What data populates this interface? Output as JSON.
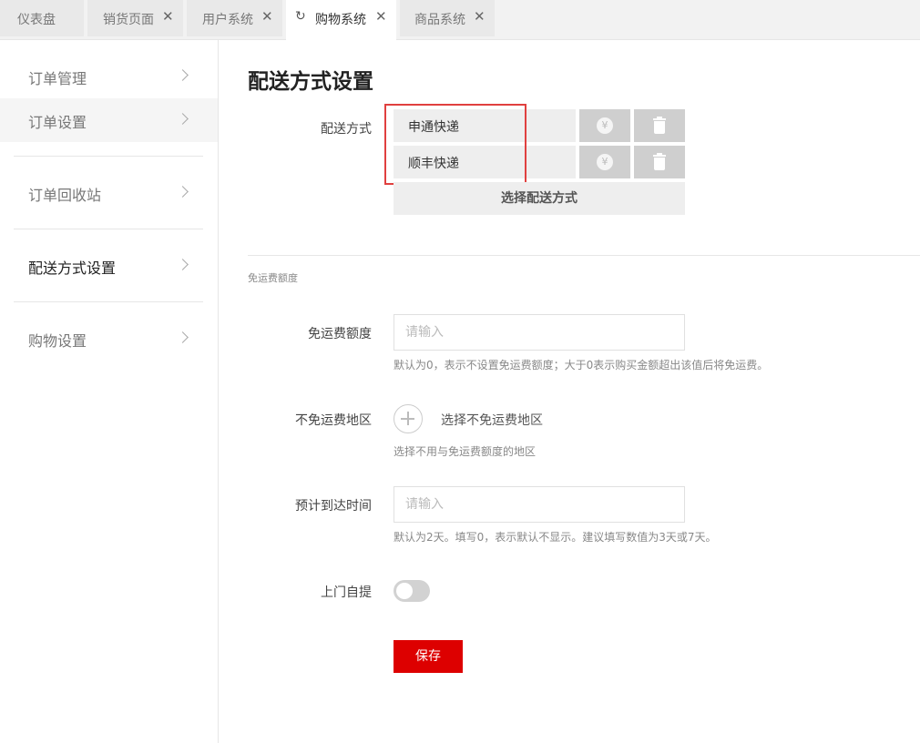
{
  "tabs": [
    {
      "label": "仪表盘",
      "closable": false
    },
    {
      "label": "销货页面",
      "closable": true,
      "close_glyph": "✕"
    },
    {
      "label": "用户系统",
      "closable": true,
      "close_glyph": "✕"
    },
    {
      "label": "购物系统",
      "closable": true,
      "active": true,
      "close_glyph": "✕",
      "icon": "reload-icon"
    },
    {
      "label": "商品系统",
      "closable": true,
      "close_glyph": "✕"
    }
  ],
  "sidebar": {
    "items": [
      {
        "label": "订单管理"
      },
      {
        "label": "订单设置"
      },
      {
        "label": "订单回收站"
      },
      {
        "label": "配送方式设置",
        "active": true
      },
      {
        "label": "购物设置"
      }
    ]
  },
  "page": {
    "title": "配送方式设置"
  },
  "shipping": {
    "label": "配送方式",
    "methods": [
      {
        "name": "申通快递"
      },
      {
        "name": "顺丰快递"
      }
    ],
    "price_icon_glyph": "¥",
    "choose_button": "选择配送方式"
  },
  "free_shipping": {
    "section_label": "免运费额度",
    "amount": {
      "label": "免运费额度",
      "placeholder": "请输入",
      "hint": "默认为0，表示不设置免运费额度；大于0表示购买金额超出该值后将免运费。"
    },
    "excluded_regions": {
      "label": "不免运费地区",
      "action": "选择不免运费地区",
      "hint": "选择不用与免运费额度的地区"
    },
    "arrival_time": {
      "label": "预计到达时间",
      "placeholder": "请输入",
      "hint": "默认为2天。填写0，表示默认不显示。建议填写数值为3天或7天。"
    },
    "pickup": {
      "label": "上门自提",
      "enabled": false
    }
  },
  "actions": {
    "save": "保存"
  },
  "colors": {
    "accent": "#dd0000",
    "highlight_border": "#e0403f"
  }
}
